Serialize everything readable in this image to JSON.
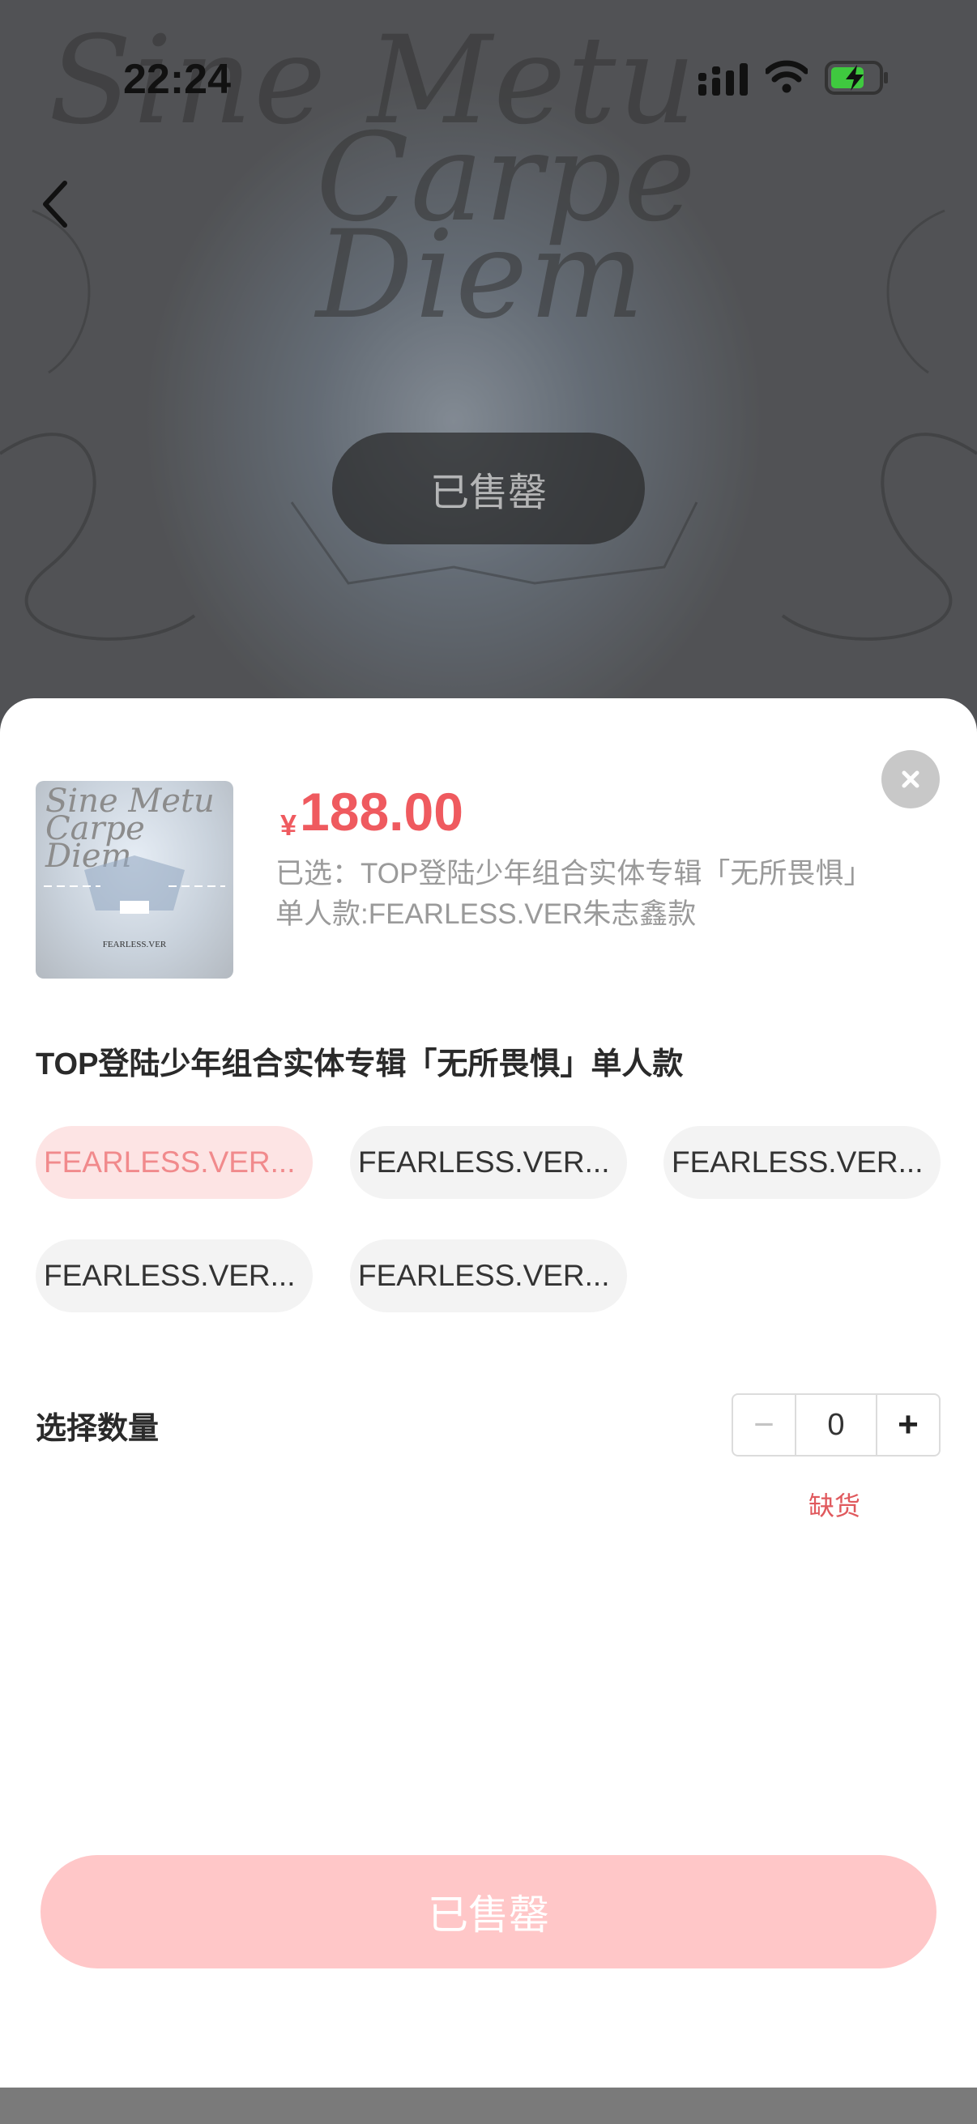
{
  "status_bar": {
    "time": "22:24",
    "battery_color": "#3fc93f"
  },
  "background": {
    "art_title_line1": "Sine Metu",
    "art_title_line2": "Carpe Diem",
    "soldout_overlay": "已售罄"
  },
  "sheet": {
    "price_currency": "¥",
    "price_value": "188.00",
    "selected_text": "已选：TOP登陆少年组合实体专辑「无所畏惧」单人款:FEARLESS.VER朱志鑫款",
    "thumb_title": "Sine Metu Carpe Diem",
    "thumb_subtitle": "FEARLESS.VER",
    "group_title": "TOP登陆少年组合实体专辑「无所畏惧」单人款",
    "options": [
      {
        "label": "FEARLESS.VER...",
        "active": true
      },
      {
        "label": "FEARLESS.VER...",
        "active": false
      },
      {
        "label": "FEARLESS.VER...",
        "active": false
      },
      {
        "label": "FEARLESS.VER...",
        "active": false
      },
      {
        "label": "FEARLESS.VER...",
        "active": false
      }
    ],
    "quantity_label": "选择数量",
    "quantity_minus": "−",
    "quantity_value": "0",
    "quantity_plus": "+",
    "out_of_stock": "缺货",
    "action_button": "已售罄"
  },
  "colors": {
    "price": "#ef5a5f",
    "accent_light": "#ffc7c8",
    "chip_active_bg": "#fde4e4"
  }
}
